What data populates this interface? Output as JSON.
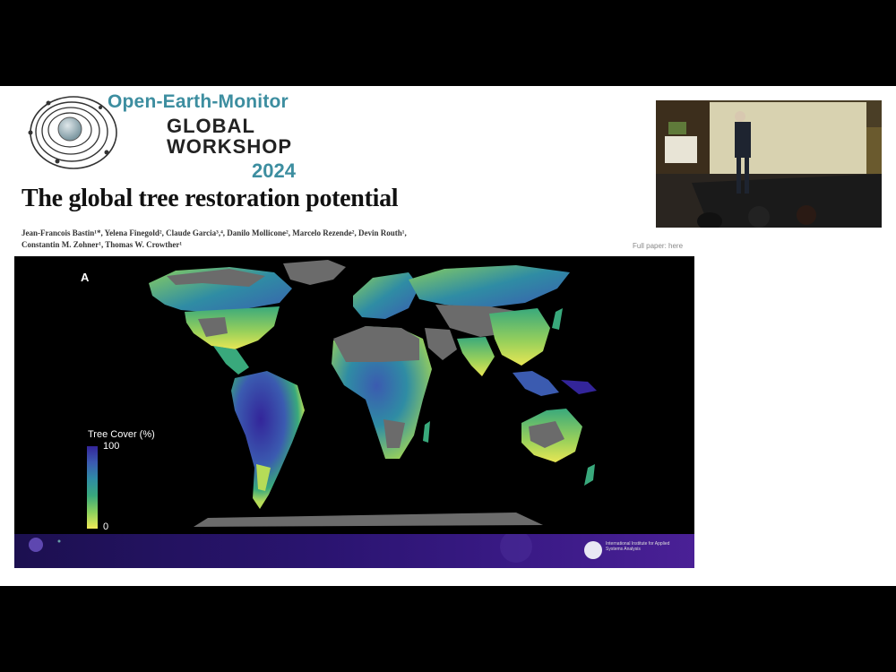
{
  "branding": {
    "line1": "Open-Earth-Monitor",
    "line2": "GLOBAL",
    "line3": "WORKSHOP",
    "line4": "2024"
  },
  "slide": {
    "title": "The global tree restoration potential",
    "authors": "Jean-Francois Bastin¹*, Yelena Finegold², Claude Garcia³,⁴, Danilo Mollicone², Marcelo Rezende², Devin Routh¹, Constantin M. Zohner¹, Thomas W. Crowther¹",
    "paper_link": "Full paper: here"
  },
  "figure": {
    "panel_letter": "A",
    "legend_title": "Tree Cover (%)",
    "legend_max": "100",
    "legend_min": "0",
    "colors": {
      "ocean": "#000000",
      "non_forest": "#6b6b6b",
      "high_cover": "#33259a",
      "mid_cover": "#2f8ca4",
      "low_cover": "#f1e957"
    }
  },
  "footer": {
    "logo_icon": "iiasa-logo-icon",
    "text": "International Institute for Applied Systems Analysis"
  },
  "webcam": {
    "icon": "speaker-video-feed"
  }
}
